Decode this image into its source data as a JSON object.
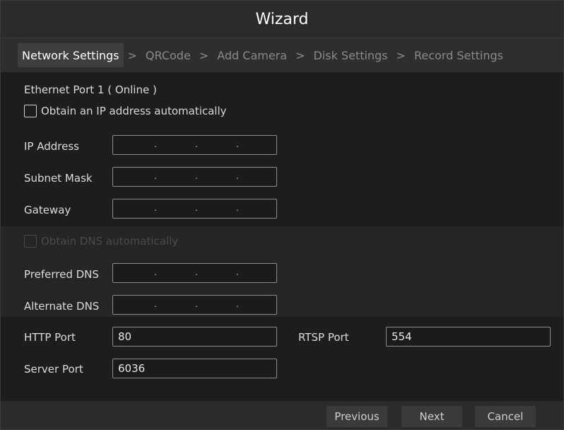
{
  "window": {
    "title": "Wizard"
  },
  "steps": [
    {
      "label": "Network Settings"
    },
    {
      "label": "QRCode"
    },
    {
      "label": "Add Camera"
    },
    {
      "label": "Disk Settings"
    },
    {
      "label": "Record Settings"
    }
  ],
  "step_separator": ">",
  "network": {
    "section_title": "Ethernet Port 1 ( Online )",
    "auto_ip_label": "Obtain an IP address automatically",
    "ip_address_label": "IP Address",
    "subnet_mask_label": "Subnet Mask",
    "gateway_label": "Gateway",
    "auto_dns_label": "Obtain DNS automatically",
    "preferred_dns_label": "Preferred DNS",
    "alternate_dns_label": "Alternate DNS",
    "http_port_label": "HTTP Port",
    "http_port_value": "80",
    "rtsp_port_label": "RTSP Port",
    "rtsp_port_value": "554",
    "server_port_label": "Server Port",
    "server_port_value": "6036",
    "ip_dot": "."
  },
  "footer": {
    "previous_label": "Previous",
    "next_label": "Next",
    "cancel_label": "Cancel"
  }
}
